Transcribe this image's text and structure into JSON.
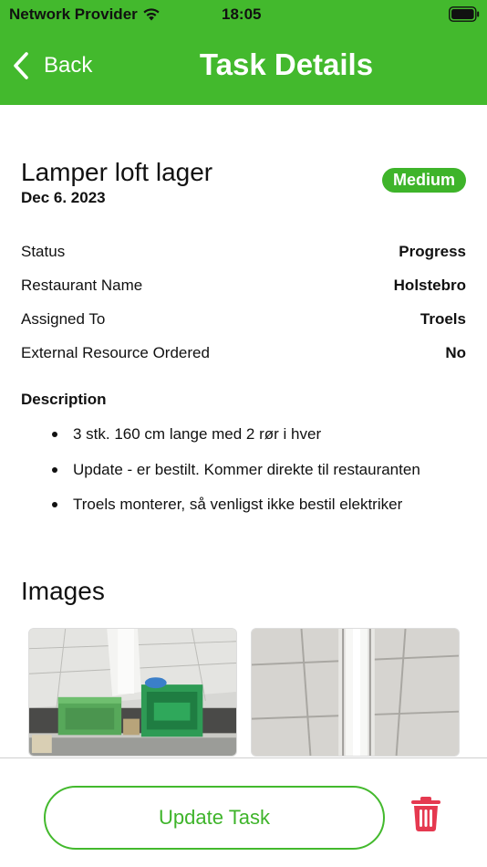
{
  "status_bar": {
    "provider": "Network Provider",
    "time": "18:05",
    "icons": [
      "wifi-icon",
      "battery-icon"
    ]
  },
  "nav": {
    "back_label": "Back",
    "title": "Task Details",
    "back_icon": "chevron-left-icon"
  },
  "task": {
    "title": "Lamper loft lager",
    "date": "Dec 6. 2023",
    "priority": "Medium"
  },
  "details": [
    {
      "label": "Status",
      "value": "Progress"
    },
    {
      "label": "Restaurant Name",
      "value": "Holstebro"
    },
    {
      "label": "Assigned To",
      "value": "Troels"
    },
    {
      "label": "External Resource Ordered",
      "value": "No"
    }
  ],
  "description": {
    "heading": "Description",
    "items": [
      "3 stk. 160 cm lange med 2 rør i hver",
      "Update - er bestilt. Kommer direkte til restauranten",
      "Troels monterer, så venligst ikke bestil elektriker"
    ]
  },
  "images": {
    "heading": "Images",
    "count": 2
  },
  "footer": {
    "update_label": "Update Task",
    "delete_icon": "trash-icon"
  },
  "colors": {
    "brand_green": "#43b92d",
    "delete_red": "#e53950"
  }
}
